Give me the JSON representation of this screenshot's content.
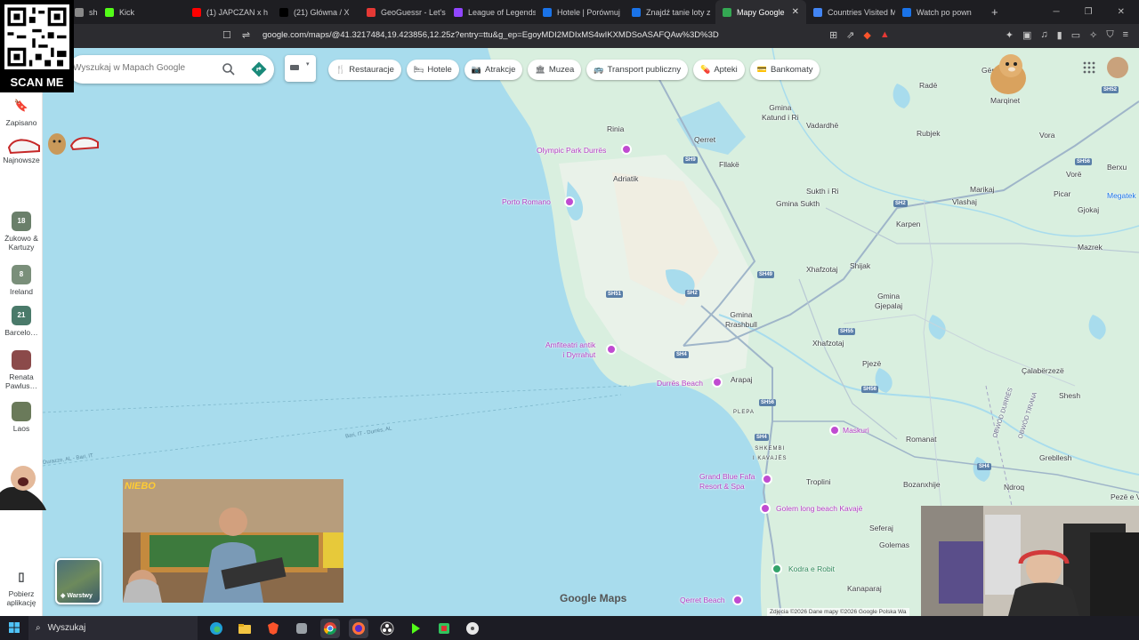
{
  "browser": {
    "tabs": [
      {
        "label": "shl",
        "color": "#888"
      },
      {
        "label": "Kick",
        "color": "#53fc18"
      },
      {
        "label": "(1) JAPCZAN x h",
        "color": "#ff0000"
      },
      {
        "label": "(21) Główna / X",
        "color": "#000000"
      },
      {
        "label": "GeoGuessr - Let's e",
        "color": "#e53935"
      },
      {
        "label": "League of Legends",
        "color": "#9146ff"
      },
      {
        "label": "Hotele | Porównuj",
        "color": "#1a73e8"
      },
      {
        "label": "Znajdź tanie loty z",
        "color": "#1a73e8"
      },
      {
        "label": "Mapy Google",
        "color": "#34a853",
        "active": true
      },
      {
        "label": "Countries Visited M",
        "color": "#4285f4"
      },
      {
        "label": "Watch po pown",
        "color": "#1a73e8"
      }
    ],
    "new_tab": "+",
    "url": "google.com/maps/@41.3217484,19.423856,12.25z?entry=ttu&g_ep=EgoyMDI2MDIxMS4wIKXMDSoASAFQAw%3D%3D"
  },
  "qr": {
    "label": "SCAN ME"
  },
  "sidebar": {
    "items": [
      {
        "label": "Zapisano",
        "icon": "bookmark-icon"
      },
      {
        "label": "Najnowsze",
        "icon": "recent-icon"
      },
      {
        "label": "Żukowo & Kartuzy",
        "badge": "18",
        "color": "#6a7f6a"
      },
      {
        "label": "Ireland",
        "badge": "8",
        "color": "#7a8f7a"
      },
      {
        "label": "Barcelo…",
        "badge": "21",
        "color": "#4a7a6a"
      },
      {
        "label": "Renata Pawlus…",
        "color": "#8b4a4a"
      },
      {
        "label": "Laos",
        "color": "#6a7a5a"
      },
      {
        "label": "Pobierz aplikację",
        "icon": "phone-icon"
      }
    ]
  },
  "search": {
    "placeholder": "Wyszukaj w Mapach Google"
  },
  "chips": [
    {
      "label": "Restauracje",
      "icon": "🍴"
    },
    {
      "label": "Hotele",
      "icon": "🛏"
    },
    {
      "label": "Atrakcje",
      "icon": "📷"
    },
    {
      "label": "Muzea",
      "icon": "🏛"
    },
    {
      "label": "Transport publiczny",
      "icon": "🚌"
    },
    {
      "label": "Apteki",
      "icon": "💊"
    },
    {
      "label": "Bankomaty",
      "icon": "💳"
    }
  ],
  "map": {
    "places": [
      {
        "label": "Radë"
      },
      {
        "label": "Gërr"
      },
      {
        "label": "Marqinet"
      },
      {
        "label": "Gmina\nKatund i Ri"
      },
      {
        "label": "Vadardhë"
      },
      {
        "label": "Rubjek"
      },
      {
        "label": "Vora"
      },
      {
        "label": "Rinia"
      },
      {
        "label": "Qerret"
      },
      {
        "label": "Fllakë"
      },
      {
        "label": "Adriatik"
      },
      {
        "label": "Sukth i Ri"
      },
      {
        "label": "Gmina Sukth"
      },
      {
        "label": "Vlashaj"
      },
      {
        "label": "Marikaj"
      },
      {
        "label": "Vorë"
      },
      {
        "label": "Picar"
      },
      {
        "label": "Gjokaj"
      },
      {
        "label": "Berxu"
      },
      {
        "label": "Karpen"
      },
      {
        "label": "Mazrek"
      },
      {
        "label": "Xhafzotaj"
      },
      {
        "label": "Shijak"
      },
      {
        "label": "Gmina\nGjepalaj"
      },
      {
        "label": "Gmina\nRrashbull"
      },
      {
        "label": "Xhafzotaj"
      },
      {
        "label": "Pjezë"
      },
      {
        "label": "Çalabërzezë"
      },
      {
        "label": "Shesh"
      },
      {
        "label": "Arapaj"
      },
      {
        "label": "Romanat"
      },
      {
        "label": "Grebllesh"
      },
      {
        "label": "Troplini"
      },
      {
        "label": "Bozanxhije"
      },
      {
        "label": "Ndroq"
      },
      {
        "label": "Pezë e Vo"
      },
      {
        "label": "Seferaj"
      },
      {
        "label": "Golemas"
      },
      {
        "label": "Kanaparaj"
      },
      {
        "label": "PLEPA"
      },
      {
        "label": "SHKEMBI\nI KAVAJËS"
      },
      {
        "label": "OBWÓD DURRËS"
      },
      {
        "label": "OBWÓD TIRANA"
      }
    ],
    "pois": [
      {
        "label": "Olympic Park Durrës"
      },
      {
        "label": "Porto Romano"
      },
      {
        "label": "Amfiteatri antik\ni Dyrrahut"
      },
      {
        "label": "Durrës Beach"
      },
      {
        "label": "Maskuri"
      },
      {
        "label": "Grand Blue Fafa\nResort & Spa"
      },
      {
        "label": "Golem long beach Kavajë"
      },
      {
        "label": "Kodra e Robit"
      },
      {
        "label": "Qerret Beach"
      },
      {
        "label": "Megatek"
      }
    ],
    "roads": [
      "SH9",
      "SH51",
      "SH2",
      "SH49",
      "SH55",
      "SH4",
      "SH56",
      "SH52",
      "SH2",
      "SH56",
      "SH4",
      "SH56",
      "SH4"
    ],
    "sea_labels": [
      "Bari, IT - Durrës, AL",
      "Durazzo, AL - Bari, IT"
    ],
    "layers_label": "Warstwy",
    "logo": "Google Maps",
    "attribution": "Zdjęcia ©2026 Dane mapy ©2026 Google   Polska   Wa"
  },
  "overlay": {
    "video_caption": "NIEBO"
  },
  "taskbar": {
    "search_label": "Wyszukaj"
  }
}
